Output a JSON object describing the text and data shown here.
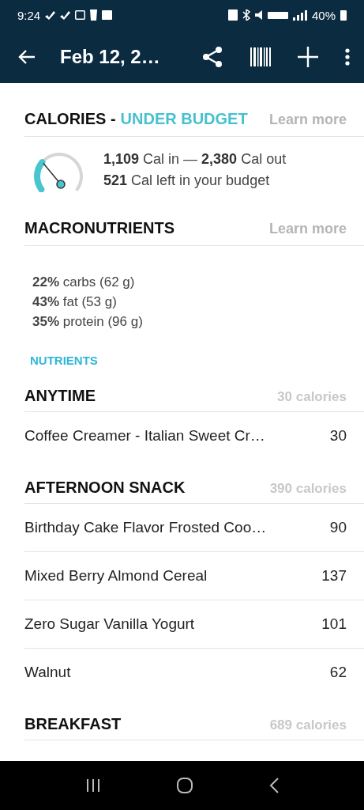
{
  "status_bar": {
    "time": "9:24",
    "battery": "40%"
  },
  "app_bar": {
    "title": "Feb 12, 2…"
  },
  "calories": {
    "title": "CALORIES - ",
    "status": "UNDER BUDGET",
    "link": "Learn more",
    "lines": [
      "**1,109** Cal in — **2,380** Cal out",
      "**521** Cal left in your budget"
    ]
  },
  "macronutrients": {
    "title": "MACRONUTRIENTS",
    "link": "Learn more",
    "lines": [
      "**22%** carbs (62 g)",
      "**43%** fat (53 g)",
      "**35%** protein (96 g)"
    ],
    "nutrients_link": "NUTRIENTS"
  },
  "meals": [
    {
      "name": "ANYTIME",
      "total": "30 calories",
      "items": [
        {
          "name": "Coffee Creamer - Italian Sweet Cr…",
          "calories": "30"
        }
      ]
    },
    {
      "name": "AFTERNOON SNACK",
      "total": "390 calories",
      "items": [
        {
          "name": "Birthday Cake Flavor Frosted Coo…",
          "calories": "90"
        },
        {
          "name": "Mixed Berry Almond Cereal",
          "calories": "137"
        },
        {
          "name": "Zero Sugar Vanilla Yogurt",
          "calories": "101"
        },
        {
          "name": "Walnut",
          "calories": "62"
        }
      ]
    },
    {
      "name": "BREAKFAST",
      "total": "689 calories"
    }
  ]
}
